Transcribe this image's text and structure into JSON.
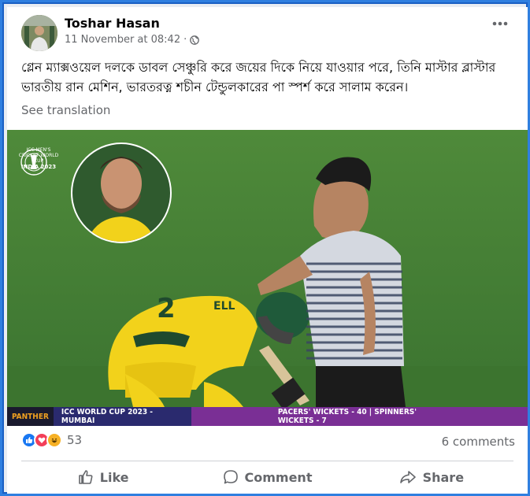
{
  "post": {
    "author": "Toshar Hasan",
    "timestamp": "11 November at 08:42",
    "audience_icon": "globe-icon",
    "text": "গ্লেন ম্যাক্সওয়েল দলকে ডাবল সেঞ্চুরি করে জয়ের দিকে নিয়ে যাওয়ার পরে, তিনি মাস্টার ব্লাস্টার ভারতীয় রান মেশিন, ভারতরত্ন শচীন টেন্ডুলকারের পা স্পর্শ করে সালাম করেন।",
    "see_translation": "See translation"
  },
  "photo": {
    "logo_line1": "ICC MEN'S",
    "logo_line2": "CRICKET WORLD CUP",
    "logo_line3": "INDIA 2023",
    "ticker_brand": "PANTHER",
    "ticker_event": "ICC WORLD CUP 2023 - MUMBAI",
    "ticker_stat": "PACERS' WICKETS - 40 | SPINNERS' WICKETS - 7",
    "jersey_text": "ELL"
  },
  "engagement": {
    "reactions": [
      "like",
      "love",
      "haha"
    ],
    "reaction_count": "53",
    "comments": "6 comments"
  },
  "actions": {
    "like": "Like",
    "comment": "Comment",
    "share": "Share"
  },
  "colors": {
    "frame": "#2f7fe0",
    "like": "#1877f2",
    "love": "#f33e58",
    "haha": "#f7b125",
    "ticker": "#5a1f6e"
  }
}
